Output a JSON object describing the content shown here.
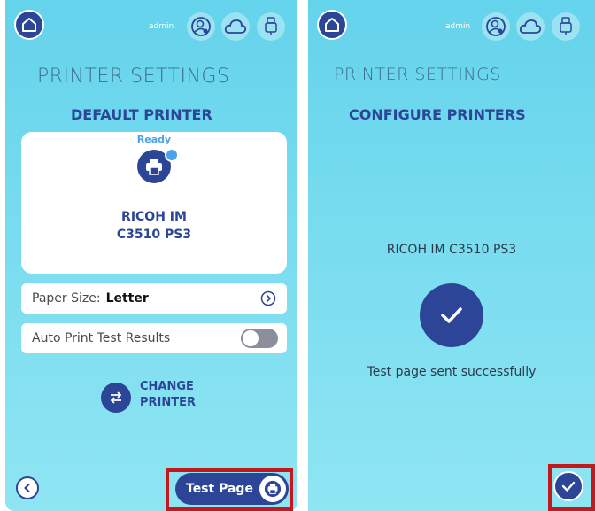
{
  "left": {
    "header": {
      "admin_label": "admin"
    },
    "title": "PRINTER SETTINGS",
    "subtitle": "DEFAULT PRINTER",
    "printer_card": {
      "status": "Ready",
      "name_line1": "RICOH IM",
      "name_line2": "C3510 PS3"
    },
    "paper_size": {
      "label": "Paper Size:",
      "value": "Letter"
    },
    "auto_print": {
      "label": "Auto Print Test Results",
      "enabled": false
    },
    "change_printer": {
      "line1": "CHANGE",
      "line2": "PRINTER"
    },
    "test_page_button": {
      "label": "Test Page"
    }
  },
  "right": {
    "header": {
      "admin_label": "admin"
    },
    "title": "PRINTER SETTINGS",
    "subtitle": "CONFIGURE PRINTERS",
    "printer_name": "RICOH IM C3510 PS3",
    "status_message": "Test page sent successfully"
  },
  "colors": {
    "primary": "#2c4596",
    "background_top": "#64d3ec",
    "background_bottom": "#8fe5f2",
    "highlight_box": "#c4181c",
    "status_dot": "#4aa3e8"
  }
}
